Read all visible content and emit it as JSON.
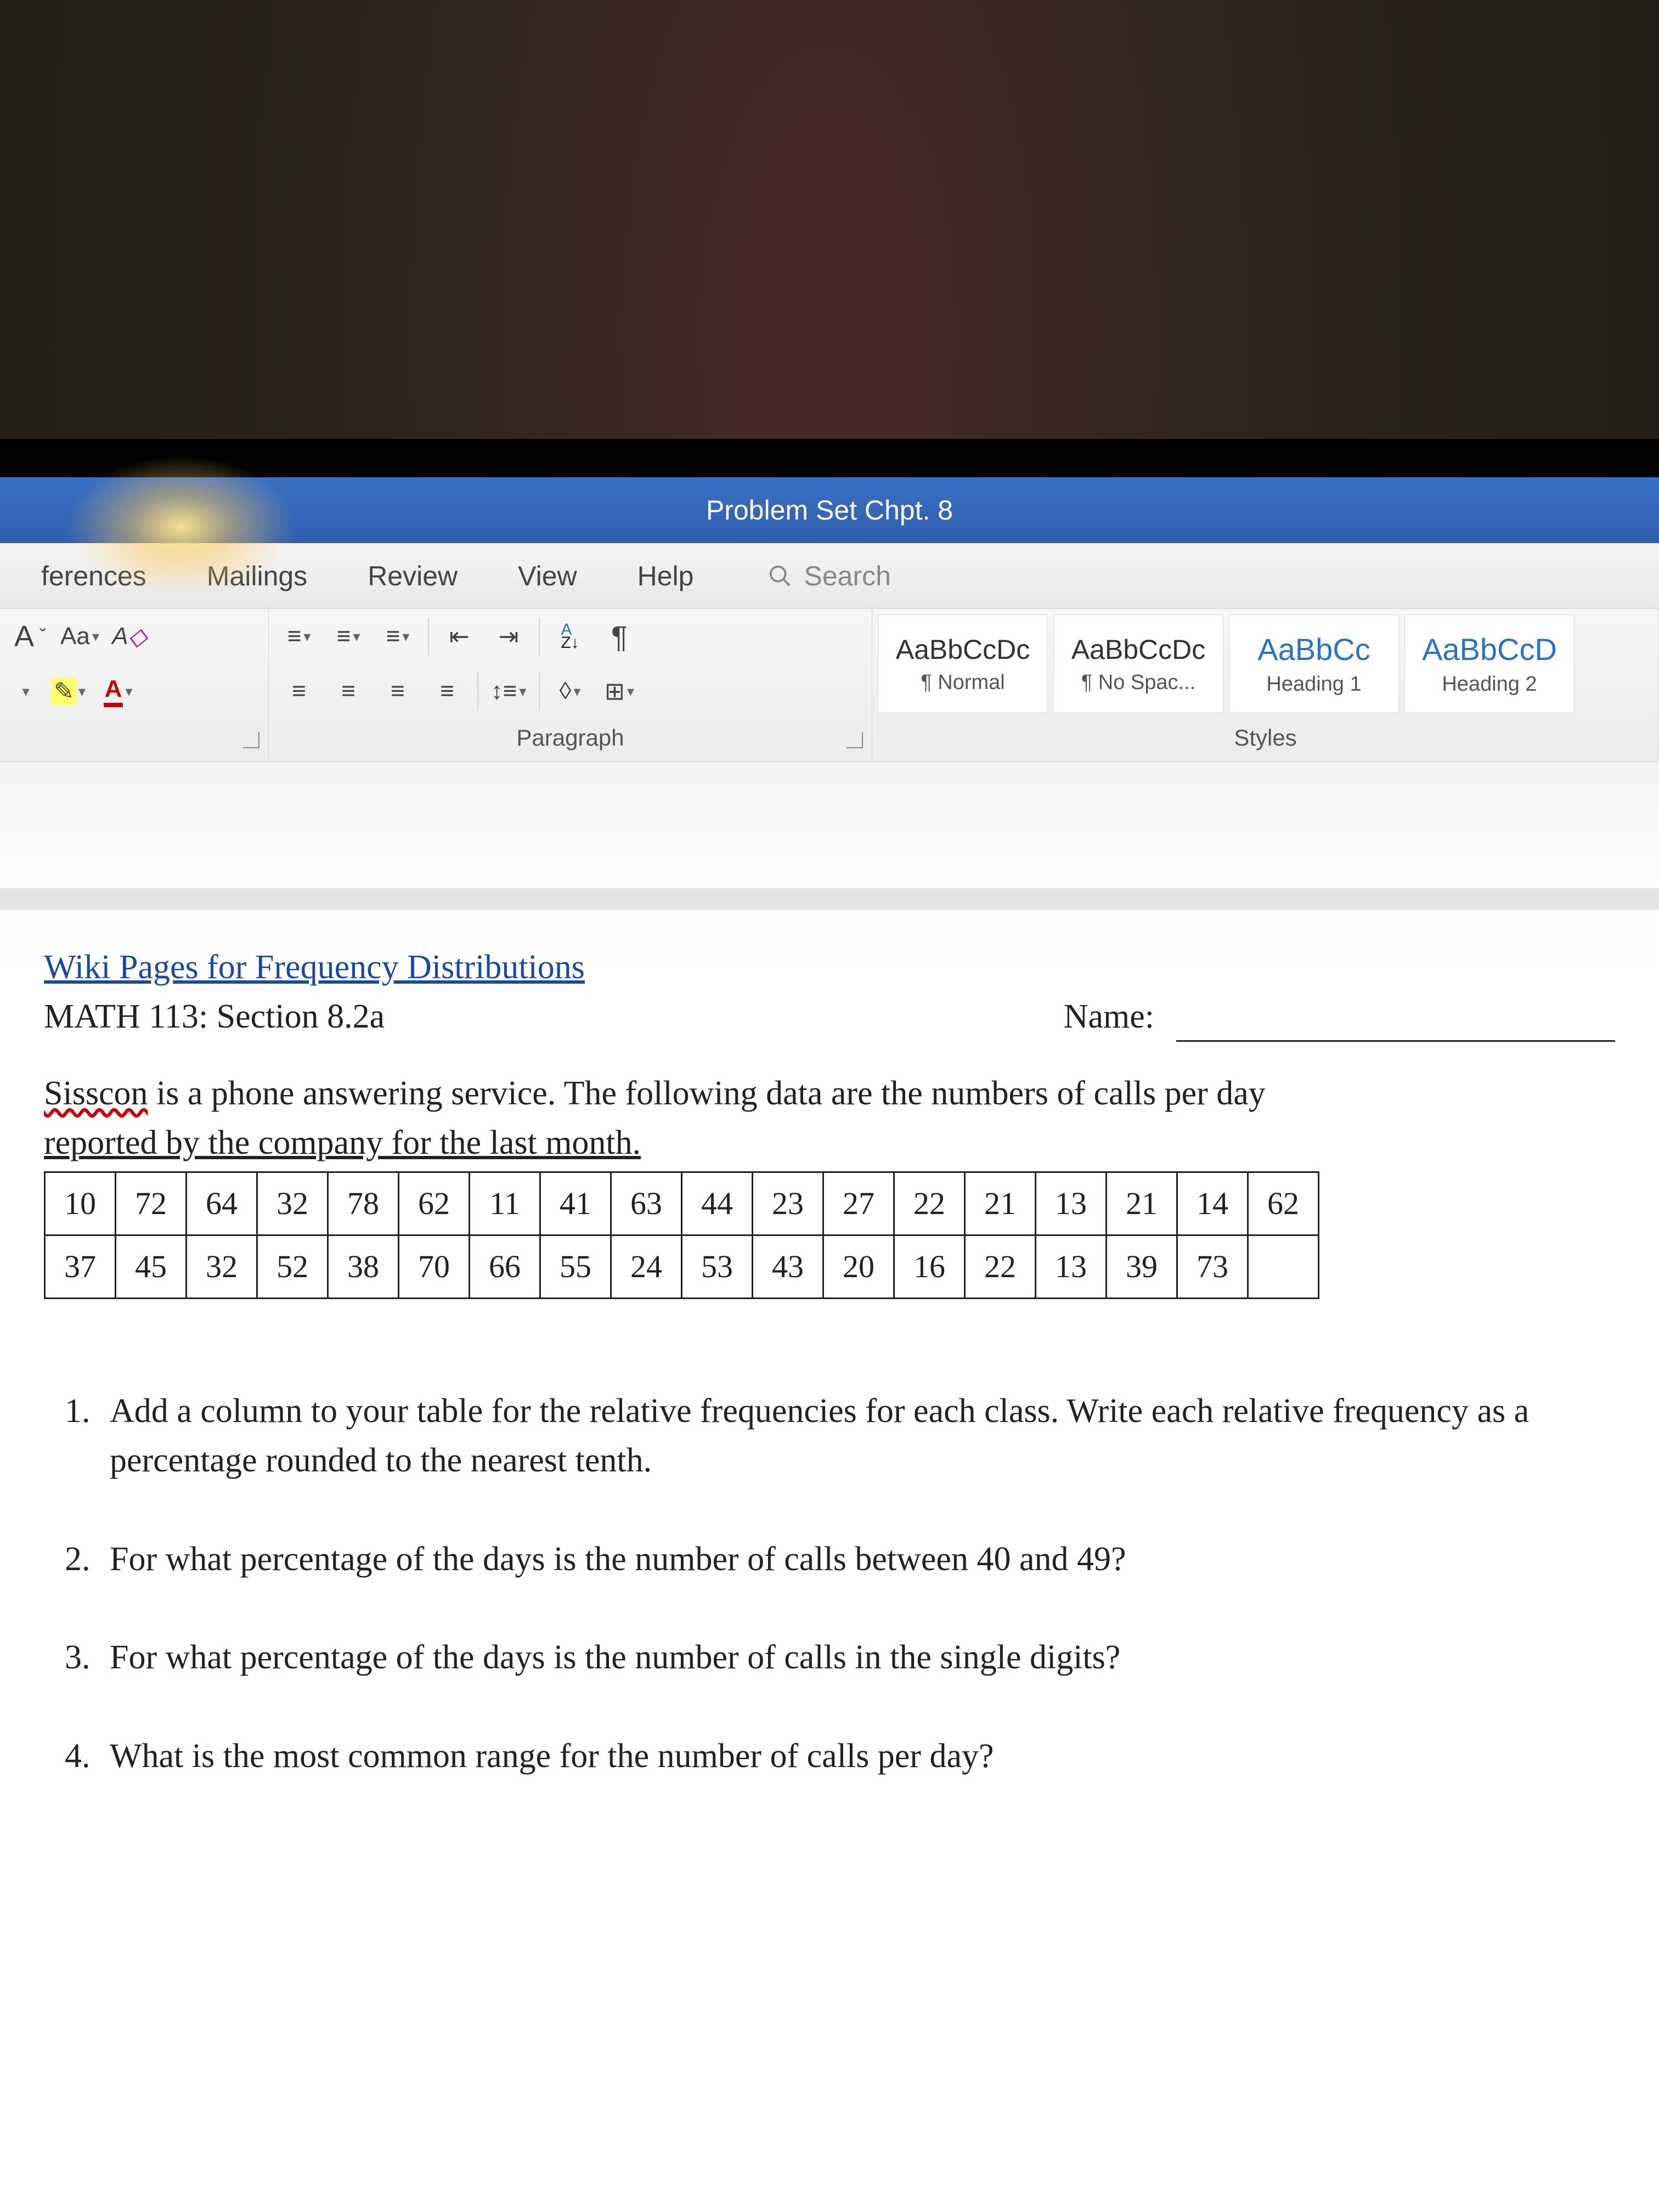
{
  "title": "Problem Set Chpt. 8",
  "tabs": [
    "ferences",
    "Mailings",
    "Review",
    "View",
    "Help"
  ],
  "search_placeholder": "Search",
  "ribbon": {
    "font_group_label": "",
    "paragraph_label": "Paragraph",
    "styles_label": "Styles"
  },
  "styles": [
    {
      "preview": "AaBbCcDc",
      "name": "¶ Normal",
      "heading": false
    },
    {
      "preview": "AaBbCcDc",
      "name": "¶ No Spac...",
      "heading": false
    },
    {
      "preview": "AaBbCc",
      "name": "Heading 1",
      "heading": true
    },
    {
      "preview": "AaBbCcD",
      "name": "Heading 2",
      "heading": true
    }
  ],
  "document": {
    "wiki_line": "Wiki Pages for Frequency Distributions",
    "course_line": "MATH 113: Section 8.2a",
    "name_label": "Name:",
    "intro_word": "Sisscon",
    "intro_rest_1": " is a phone answering service. The following data are the numbers of calls per day",
    "intro_line2": "reported by the company for the last month.",
    "table": {
      "row1": [
        "10",
        "72",
        "64",
        "32",
        "78",
        "62",
        "11",
        "41",
        "63",
        "44",
        "23",
        "27",
        "22",
        "21",
        "13",
        "21",
        "14",
        "62"
      ],
      "row2": [
        "37",
        "45",
        "32",
        "52",
        "38",
        "70",
        "66",
        "55",
        "24",
        "53",
        "43",
        "20",
        "16",
        "22",
        "13",
        "39",
        "73",
        ""
      ]
    },
    "questions": [
      "Add a column to your table for the relative frequencies for each class. Write each relative frequency as a percentage rounded to the nearest tenth.",
      "For what percentage of the days is the number of calls between 40 and 49?",
      "For what percentage of the days is the number of calls in the single digits?",
      "What is the most common range for the number of calls per day?"
    ]
  }
}
